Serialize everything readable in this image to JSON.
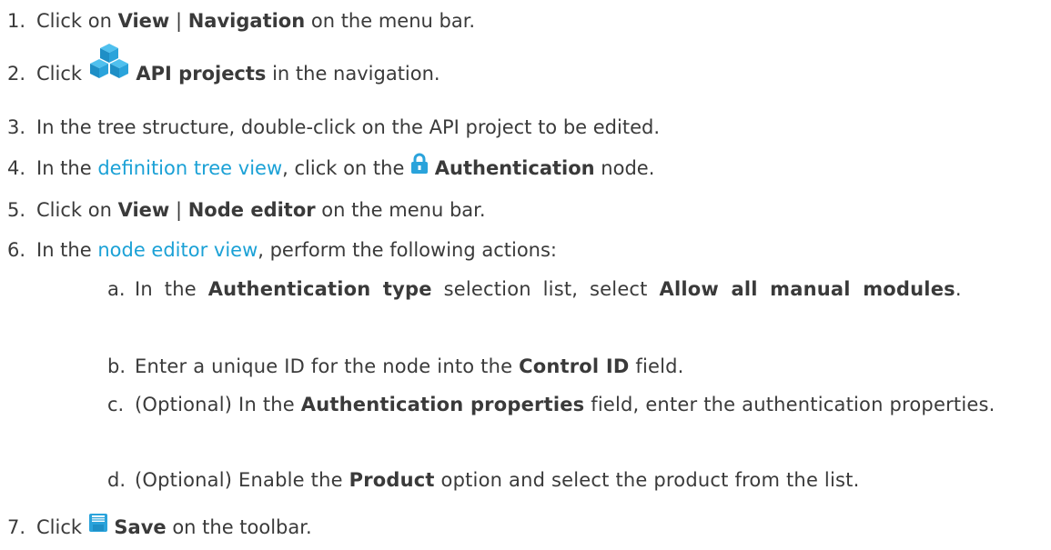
{
  "steps": [
    {
      "num": "1.",
      "pre": "Click on ",
      "b1": "View",
      "sep": " | ",
      "b2": "Navigation",
      "post": " on the menu bar."
    },
    {
      "num": "2.",
      "pre": "Click ",
      "icon": "api-projects-cubes-icon",
      "b1": "API projects",
      "post": " in the navigation."
    },
    {
      "num": "3.",
      "text": "In the tree structure, double-click on the API project to be edited."
    },
    {
      "num": "4.",
      "pre": "In the ",
      "link": "definition tree view",
      "mid": ", click on the ",
      "icon": "lock-icon",
      "b1": "Authentication",
      "post": " node."
    },
    {
      "num": "5.",
      "pre": "Click on ",
      "b1": "View",
      "sep": " | ",
      "b2": "Node editor",
      "post": " on the menu bar."
    },
    {
      "num": "6.",
      "pre": "In the ",
      "link": "node editor view",
      "post": ", perform the following actions:"
    },
    {
      "num": "7.",
      "pre": "Click ",
      "icon": "save-icon",
      "b1": "Save",
      "post": " on the toolbar."
    }
  ],
  "substeps": [
    {
      "letter": "a.",
      "pre": "In the ",
      "b1": "Authentication type",
      "mid": " selection list, select ",
      "b2": "Allow all manual modules",
      "post": "."
    },
    {
      "letter": "b.",
      "pre": "Enter a unique ID for the node into the ",
      "b1": "Control ID",
      "post": " field."
    },
    {
      "letter": "c.",
      "pre": "(Optional) In the ",
      "b1": "Authentication properties",
      "post": " field, enter the authentication properties."
    },
    {
      "letter": "d.",
      "pre": "(Optional) Enable the ",
      "b1": "Product",
      "post": " option and select the product from the list."
    }
  ],
  "colors": {
    "link": "#1ba1d6",
    "text": "#3a3a3a",
    "icon_blue": "#2aa3db"
  }
}
